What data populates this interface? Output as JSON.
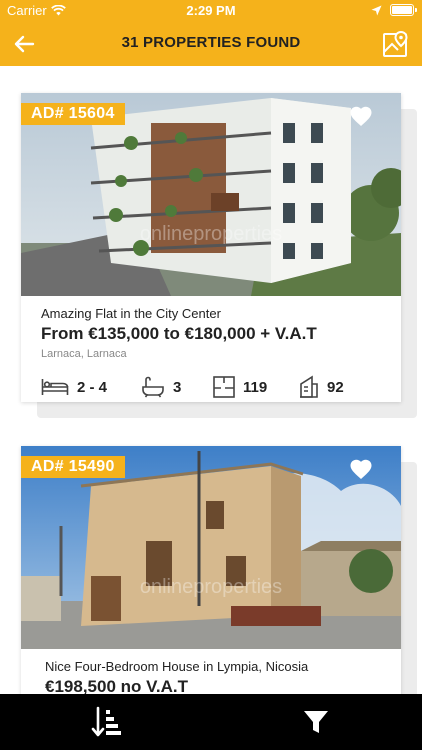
{
  "status_bar": {
    "carrier": "Carrier",
    "time": "2:29 PM"
  },
  "header": {
    "title": "31 PROPERTIES FOUND"
  },
  "listings": [
    {
      "ad": "AD# 15604",
      "title": "Amazing Flat in the City Center",
      "price": "From €135,000 to €180,000 + V.A.T",
      "location": "Larnaca, Larnaca",
      "bedrooms": "2 - 4",
      "bathrooms": "3",
      "area": "119",
      "plot": "92",
      "watermark": "onlineproperties"
    },
    {
      "ad": "AD# 15490",
      "title": "Nice Four-Bedroom House in Lympia, Nicosia",
      "price": "€198,500 no V.A.T",
      "watermark": "onlineproperties"
    }
  ],
  "colors": {
    "accent": "#f5b21b",
    "bottom_bar": "#000000"
  },
  "icons": {
    "back": "arrow-left-icon",
    "map": "map-pin-icon",
    "favorite": "heart-icon",
    "sort": "sort-icon",
    "filter": "filter-icon"
  }
}
